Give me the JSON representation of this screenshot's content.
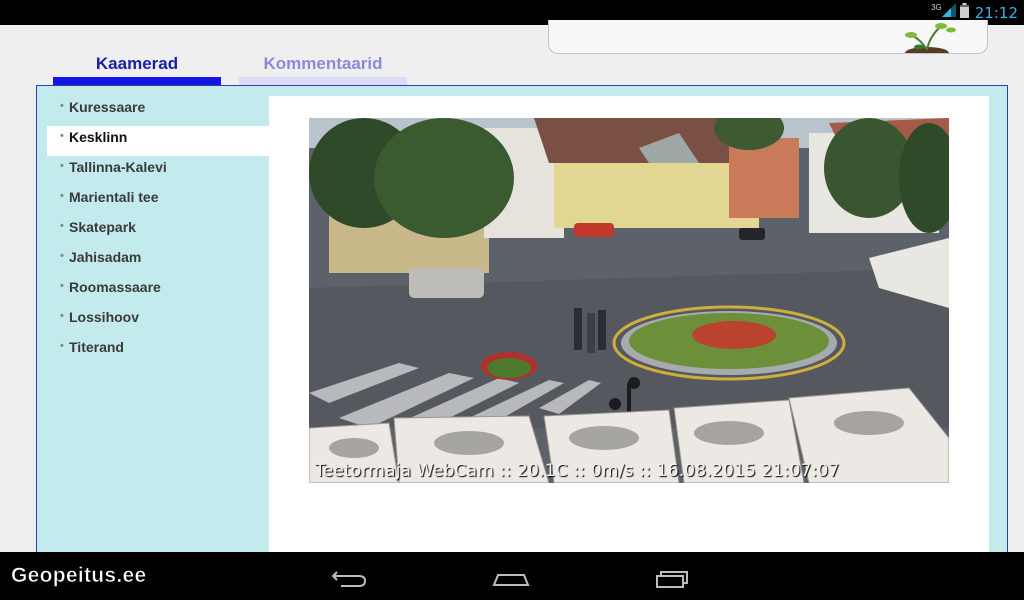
{
  "status_bar": {
    "network": "3G",
    "time": "21:12"
  },
  "tabs": [
    {
      "label": "Kaamerad",
      "active": true
    },
    {
      "label": "Kommentaarid",
      "active": false
    }
  ],
  "sidebar": {
    "items": [
      {
        "label": "Kuressaare",
        "active": false
      },
      {
        "label": "Kesklinn",
        "active": true
      },
      {
        "label": "Tallinna-Kalevi",
        "active": false
      },
      {
        "label": "Marientali tee",
        "active": false
      },
      {
        "label": "Skatepark",
        "active": false
      },
      {
        "label": "Jahisadam",
        "active": false
      },
      {
        "label": "Roomassaare",
        "active": false
      },
      {
        "label": "Lossihoov",
        "active": false
      },
      {
        "label": "Titerand",
        "active": false
      }
    ]
  },
  "webcam": {
    "caption": "Teetormaja WebCam :: 20.1C :: 0m/s :: 16.08.2015 21:07:07"
  },
  "watermark": "Geopeitus.ee",
  "colors": {
    "accent": "#1515e8",
    "panel_bg": "#c3eaec",
    "status_icon": "#33b5e5"
  },
  "icons": [
    "signal-icon",
    "battery-icon",
    "plant-icon",
    "back-icon",
    "home-icon",
    "recent-apps-icon"
  ]
}
